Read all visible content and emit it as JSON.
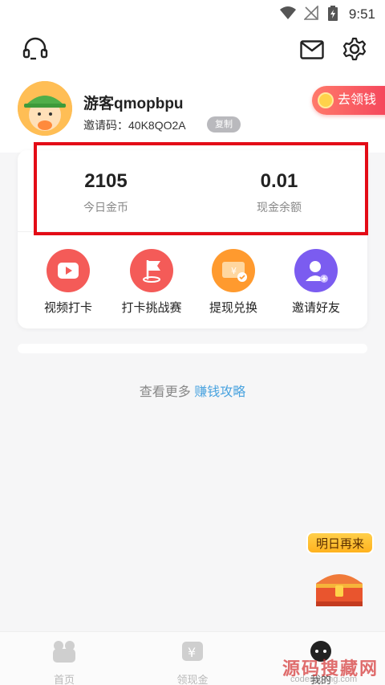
{
  "status_bar": {
    "time": "9:51"
  },
  "header": {
    "support_icon": "headset-icon",
    "mail_icon": "mail-icon",
    "settings_icon": "gear-icon"
  },
  "user": {
    "name": "游客qmopbpu",
    "invite_label": "邀请码：40K8QO2A",
    "copy_label": "复制",
    "earn_button": "去领钱"
  },
  "stats": [
    {
      "value": "2105",
      "label": "今日金币"
    },
    {
      "value": "0.01",
      "label": "现金余额"
    }
  ],
  "actions": [
    {
      "label": "视频打卡",
      "icon": "video-play-icon",
      "color": "#f45b58"
    },
    {
      "label": "打卡挑战赛",
      "icon": "flag-icon",
      "color": "#f45b58"
    },
    {
      "label": "提现兑换",
      "icon": "withdraw-icon",
      "color": "#ff9a2e"
    },
    {
      "label": "邀请好友",
      "icon": "invite-user-icon",
      "color": "#7b5cf0"
    }
  ],
  "more": {
    "prefix": "查看更多",
    "link": "赚钱攻略"
  },
  "floating": {
    "bubble": "明日再来"
  },
  "tabbar": [
    {
      "label": "首页",
      "icon": "home-icon"
    },
    {
      "label": "领现金",
      "icon": "cash-icon"
    },
    {
      "label": "我的",
      "icon": "profile-icon"
    }
  ],
  "watermark": {
    "text": "源码搜藏网",
    "sub": "codesocang.com"
  },
  "colors": {
    "accent_red": "#f4435b",
    "highlight_border": "#e30b16",
    "link_blue": "#4aa3df"
  }
}
